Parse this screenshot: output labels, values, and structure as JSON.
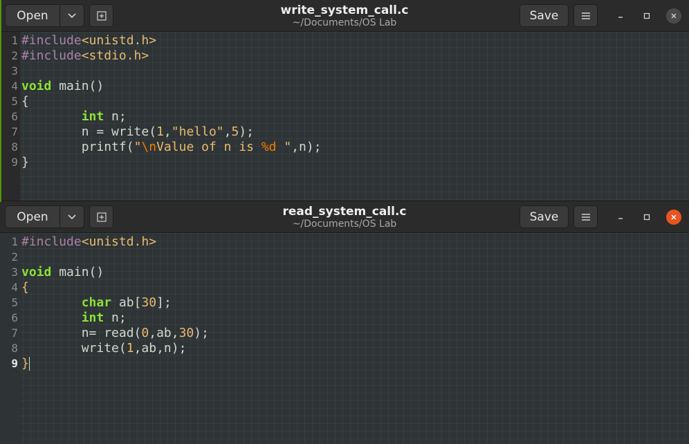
{
  "window1": {
    "title": "write_system_call.c",
    "subtitle": "~/Documents/OS Lab",
    "open_label": "Open",
    "save_label": "Save",
    "line_numbers": [
      "1",
      "2",
      "3",
      "4",
      "5",
      "6",
      "7",
      "8",
      "9"
    ],
    "code_lines": [
      "#include<unistd.h>",
      "#include<stdio.h>",
      "",
      "void main()",
      "{",
      "        int n;",
      "        n = write(1,\"hello\",5);",
      "        printf(\"\\nValue of n is %d \",n);",
      "}"
    ]
  },
  "window2": {
    "title": "read_system_call.c",
    "subtitle": "~/Documents/OS Lab",
    "open_label": "Open",
    "save_label": "Save",
    "line_numbers": [
      "1",
      "2",
      "3",
      "4",
      "5",
      "6",
      "7",
      "8",
      "9"
    ],
    "code_lines": [
      "#include<unistd.h>",
      "",
      "void main()",
      "{",
      "        char ab[30];",
      "        int n;",
      "        n= read(0,ab,30);",
      "        write(1,ab,n);",
      "}"
    ]
  },
  "colors": {
    "accent_close": "#e95420",
    "keyword": "#8ae234",
    "preprocessor": "#ad7fa8",
    "string": "#e9b96e"
  }
}
